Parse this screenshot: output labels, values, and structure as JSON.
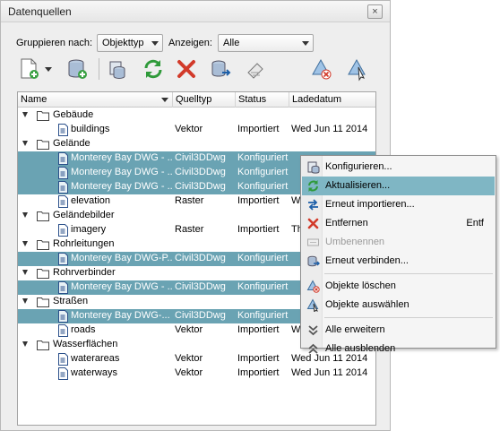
{
  "window": {
    "title": "Datenquellen",
    "close": "×"
  },
  "filter": {
    "group_label": "Gruppieren nach:",
    "group_value": "Objekttyp",
    "show_label": "Anzeigen:",
    "show_value": "Alle"
  },
  "toolbar": {
    "icons": [
      "new-data-source-icon",
      "add-database-icon",
      "database-properties-icon",
      "refresh-icon",
      "remove-icon",
      "reconnect-icon",
      "export-icon",
      "feature-remove-icon",
      "feature-select-icon"
    ]
  },
  "columns": {
    "name": "Name",
    "type": "Quelltyp",
    "status": "Status",
    "date": "Ladedatum"
  },
  "rows": [
    {
      "kind": "group",
      "name": "Gebäude"
    },
    {
      "kind": "item",
      "name": "buildings",
      "type": "Vektor",
      "status": "Importiert",
      "date": "Wed Jun 11 2014"
    },
    {
      "kind": "group",
      "name": "Gelände"
    },
    {
      "kind": "item",
      "selected": true,
      "name": "Monterey Bay DWG - ...",
      "type": "Civil3DDwg",
      "status": "Konfiguriert",
      "date": ""
    },
    {
      "kind": "item",
      "selected": true,
      "name": "Monterey Bay DWG - ...",
      "type": "Civil3DDwg",
      "status": "Konfiguriert",
      "date": ""
    },
    {
      "kind": "item",
      "selected": true,
      "name": "Monterey Bay DWG - ...",
      "type": "Civil3DDwg",
      "status": "Konfiguriert",
      "date": ""
    },
    {
      "kind": "item",
      "name": "elevation",
      "type": "Raster",
      "status": "Importiert",
      "date": "We"
    },
    {
      "kind": "group",
      "name": "Geländebilder"
    },
    {
      "kind": "item",
      "name": "imagery",
      "type": "Raster",
      "status": "Importiert",
      "date": "Th"
    },
    {
      "kind": "group",
      "name": "Rohrleitungen"
    },
    {
      "kind": "item",
      "selected": true,
      "name": "Monterey Bay DWG-P...",
      "type": "Civil3DDwg",
      "status": "Konfiguriert",
      "date": ""
    },
    {
      "kind": "group",
      "name": "Rohrverbinder"
    },
    {
      "kind": "item",
      "selected": true,
      "name": "Monterey Bay DWG - ...",
      "type": "Civil3DDwg",
      "status": "Konfiguriert",
      "date": ""
    },
    {
      "kind": "group",
      "name": "Straßen"
    },
    {
      "kind": "item",
      "selected": true,
      "name": "Monterey Bay DWG-...",
      "type": "Civil3DDwg",
      "status": "Konfiguriert",
      "date": ""
    },
    {
      "kind": "item",
      "name": "roads",
      "type": "Vektor",
      "status": "Importiert",
      "date": "We"
    },
    {
      "kind": "group",
      "name": "Wasserflächen"
    },
    {
      "kind": "item",
      "name": "waterareas",
      "type": "Vektor",
      "status": "Importiert",
      "date": "Wed Jun 11 2014"
    },
    {
      "kind": "item",
      "name": "waterways",
      "type": "Vektor",
      "status": "Importiert",
      "date": "Wed Jun 11 2014"
    }
  ],
  "context_menu": [
    {
      "label": "Konfigurieren...",
      "icon": "configure-icon"
    },
    {
      "label": "Aktualisieren...",
      "icon": "refresh-icon",
      "highlighted": true
    },
    {
      "label": "Erneut importieren...",
      "icon": "reimport-icon"
    },
    {
      "label": "Entfernen",
      "icon": "remove-icon",
      "shortcut": "Entf"
    },
    {
      "label": "Umbenennen",
      "icon": "rename-icon",
      "disabled": true
    },
    {
      "label": "Erneut verbinden...",
      "icon": "reconnect-icon"
    },
    {
      "separator": true
    },
    {
      "label": "Objekte löschen",
      "icon": "delete-objects-icon"
    },
    {
      "label": "Objekte auswählen",
      "icon": "select-objects-icon"
    },
    {
      "separator": true
    },
    {
      "label": "Alle erweitern",
      "icon": "expand-all-icon"
    },
    {
      "label": "Alle ausblenden",
      "icon": "collapse-all-icon"
    }
  ],
  "colors": {
    "selection": "#6aa3b3",
    "menu_highlight": "#7fb6c4",
    "accent_green": "#2f9a3a",
    "accent_red": "#d23a2a"
  }
}
